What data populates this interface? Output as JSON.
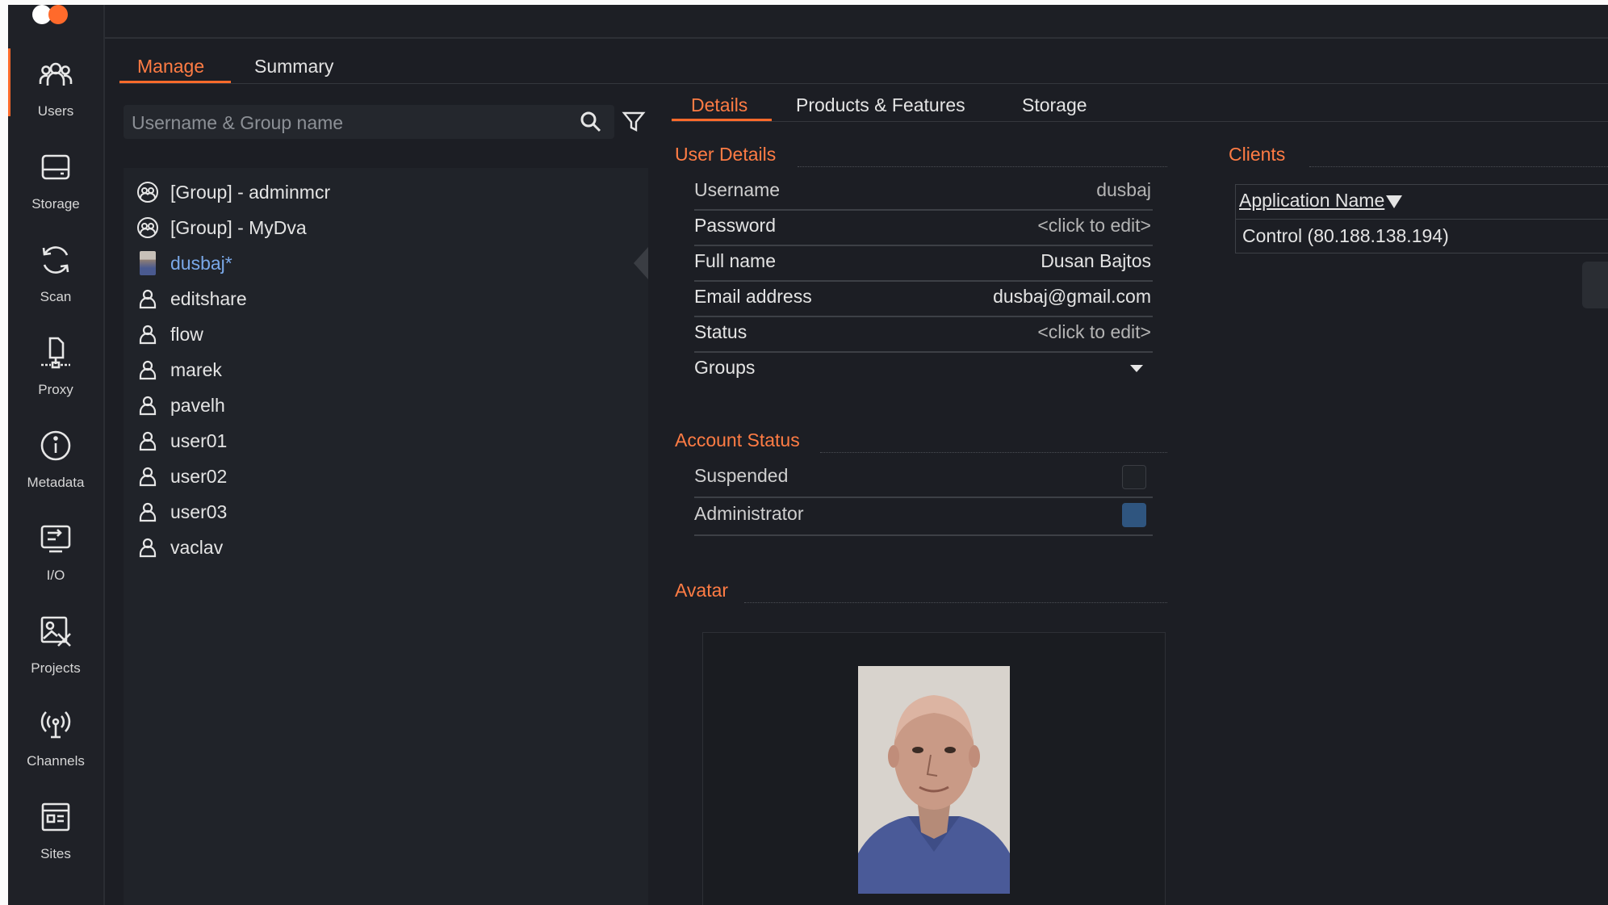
{
  "nav": {
    "items": [
      {
        "label": "Users",
        "icon": "users-icon"
      },
      {
        "label": "Storage",
        "icon": "storage-icon"
      },
      {
        "label": "Scan",
        "icon": "scan-icon"
      },
      {
        "label": "Proxy",
        "icon": "proxy-icon"
      },
      {
        "label": "Metadata",
        "icon": "info-icon"
      },
      {
        "label": "I/O",
        "icon": "io-icon"
      },
      {
        "label": "Projects",
        "icon": "projects-icon"
      },
      {
        "label": "Channels",
        "icon": "channels-icon"
      },
      {
        "label": "Sites",
        "icon": "sites-icon"
      }
    ],
    "active": "Users"
  },
  "tabs": {
    "manage": "Manage",
    "summary": "Summary",
    "active": "Manage"
  },
  "search": {
    "placeholder": "Username & Group name",
    "value": ""
  },
  "user_list": [
    {
      "label": "[Group] - adminmcr",
      "type": "group"
    },
    {
      "label": "[Group] - MyDva",
      "type": "group"
    },
    {
      "label": "dusbaj*",
      "type": "user-avatar",
      "selected": true
    },
    {
      "label": "editshare",
      "type": "user"
    },
    {
      "label": "flow",
      "type": "user"
    },
    {
      "label": "marek",
      "type": "user"
    },
    {
      "label": "pavelh",
      "type": "user"
    },
    {
      "label": "user01",
      "type": "user"
    },
    {
      "label": "user02",
      "type": "user"
    },
    {
      "label": "user03",
      "type": "user"
    },
    {
      "label": "vaclav",
      "type": "user"
    }
  ],
  "detail_tabs": {
    "details": "Details",
    "products": "Products & Features",
    "storage": "Storage",
    "active": "Details"
  },
  "user_details": {
    "title": "User Details",
    "username": {
      "label": "Username",
      "value": "dusbaj"
    },
    "password": {
      "label": "Password",
      "value": "<click to edit>"
    },
    "full_name": {
      "label": "Full name",
      "value": "Dusan Bajtos"
    },
    "email": {
      "label": "Email address",
      "value": "dusbaj@gmail.com"
    },
    "status": {
      "label": "Status",
      "value": "<click to edit>"
    },
    "groups": {
      "label": "Groups"
    }
  },
  "account_status": {
    "title": "Account Status",
    "suspended": {
      "label": "Suspended",
      "checked": false
    },
    "administrator": {
      "label": "Administrator",
      "checked": true
    }
  },
  "avatar": {
    "title": "Avatar"
  },
  "clients": {
    "title": "Clients",
    "column": "Application Name",
    "rows": [
      "Control (80.188.138.194)"
    ]
  },
  "colors": {
    "accent": "#ff6a2b",
    "selected_text": "#7aa8e8",
    "checkbox_on": "#2f557f",
    "background": "#1c1e24"
  }
}
